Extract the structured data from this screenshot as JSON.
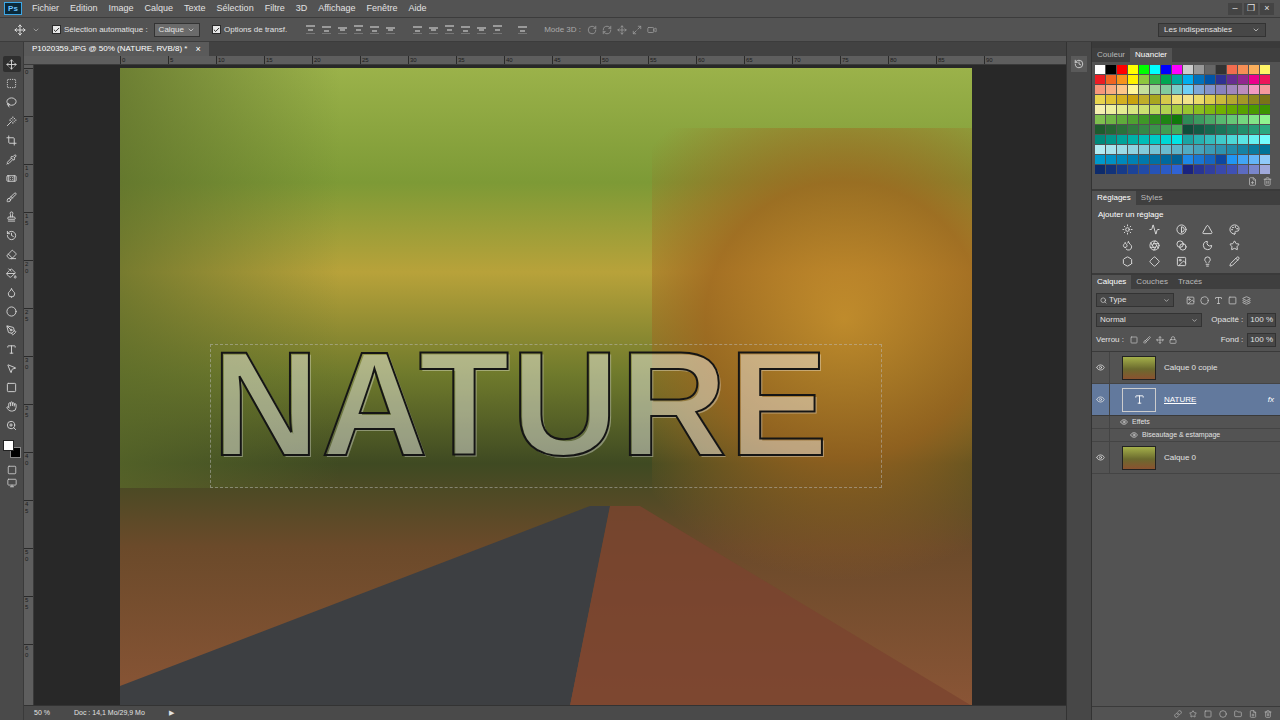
{
  "app": {
    "logo": "Ps"
  },
  "menu": [
    "Fichier",
    "Edition",
    "Image",
    "Calque",
    "Texte",
    "Sélection",
    "Filtre",
    "3D",
    "Affichage",
    "Fenêtre",
    "Aide"
  ],
  "window_controls": [
    "–",
    "❐",
    "×"
  ],
  "options_bar": {
    "auto_select": {
      "label": "Sélection automatique :",
      "checked": true
    },
    "auto_select_target": "Calque",
    "transform_controls": {
      "label": "Options de transf.",
      "checked": true
    },
    "mode_3d_label": "Mode 3D :",
    "workspace": "Les indispensables"
  },
  "document_tab": {
    "title": "P1020359.JPG @ 50% (NATURE, RVB/8) *",
    "close": "×"
  },
  "ruler_h": [
    "0",
    "5",
    "10",
    "15",
    "20",
    "25",
    "30",
    "35",
    "40",
    "45",
    "50",
    "55",
    "60",
    "65",
    "70",
    "75",
    "80",
    "85",
    "90"
  ],
  "ruler_v": [
    "0",
    "5",
    "10",
    "15",
    "20",
    "25",
    "30",
    "35",
    "40",
    "45",
    "50",
    "55",
    "60"
  ],
  "canvas": {
    "text_layer": "NATURE"
  },
  "status_bar": {
    "zoom": "50 %",
    "doc": "Doc : 14,1 Mo/29,9 Mo",
    "arrow": "▶"
  },
  "tools": [
    {
      "selected": true
    },
    {
      "selected": false
    },
    {
      "selected": false
    },
    {
      "selected": false
    },
    {
      "selected": false
    },
    {
      "selected": false
    },
    {
      "selected": false
    },
    {
      "selected": false
    },
    {
      "selected": false
    },
    {
      "selected": false
    },
    {
      "selected": false
    },
    {
      "selected": false
    },
    {
      "selected": false
    },
    {
      "selected": false
    },
    {
      "selected": false
    },
    {
      "selected": false
    },
    {
      "selected": false
    },
    {
      "selected": false
    },
    {
      "selected": false
    },
    {
      "selected": false
    }
  ],
  "colors": {
    "foreground": "#ffffff",
    "background": "#000000"
  },
  "panels": {
    "color": {
      "tabs": [
        {
          "label": "Couleur",
          "selected": false
        },
        {
          "label": "Nuancier",
          "selected": true
        }
      ],
      "swatches": [
        [
          "#ffffff",
          "#000000",
          "#ff0000",
          "#ffff00",
          "#00ff00",
          "#00ffff",
          "#0000ff",
          "#ff00ff",
          "#cccccc",
          "#999999",
          "#666666",
          "#333333",
          "#f26c4f",
          "#f68e55",
          "#fbaf5c",
          "#fff467"
        ],
        [
          "#ed1c24",
          "#f26522",
          "#f7941d",
          "#fff200",
          "#8dc73f",
          "#39b54a",
          "#00a651",
          "#00a99d",
          "#00aeef",
          "#0072bc",
          "#0054a6",
          "#2e3192",
          "#662d91",
          "#92278f",
          "#ec008c",
          "#ed145b"
        ],
        [
          "#f7977a",
          "#f9ad81",
          "#fdc68a",
          "#fff79a",
          "#c4df9b",
          "#a3d39c",
          "#82ca9d",
          "#7bcdc8",
          "#6ecff6",
          "#7ea7d8",
          "#8493ca",
          "#8882be",
          "#a187be",
          "#bc8dbf",
          "#f49ac2",
          "#f6989d"
        ],
        [
          "#e8d44d",
          "#e0c233",
          "#d4b021",
          "#c9a30f",
          "#bfae2a",
          "#a8a620",
          "#d6c94a",
          "#efe07a",
          "#f2e38b",
          "#eadb6a",
          "#dccc4c",
          "#c8b93a",
          "#b5a82f",
          "#a39827",
          "#8f861f",
          "#7a7318"
        ],
        [
          "#f5f0b0",
          "#eef0a0",
          "#e4ec90",
          "#d8e680",
          "#cce070",
          "#bfd960",
          "#b2d250",
          "#a5cb40",
          "#98c430",
          "#8bbd20",
          "#7eb610",
          "#71af00",
          "#64a800",
          "#57a100",
          "#4a9a00",
          "#3d9300"
        ],
        [
          "#7fbf4f",
          "#6fb545",
          "#5fab3b",
          "#4fa131",
          "#3f9727",
          "#2f8d1d",
          "#1f8313",
          "#0f7909",
          "#2e8b57",
          "#3c9a5f",
          "#4aa967",
          "#58b86f",
          "#66c777",
          "#74d67f",
          "#82e587",
          "#90f48f"
        ],
        [
          "#1e5b2e",
          "#246634",
          "#2a713a",
          "#307c40",
          "#368746",
          "#3c924c",
          "#429d52",
          "#48a858",
          "#0f4d3a",
          "#135a44",
          "#17674e",
          "#1b7458",
          "#1f8162",
          "#238e6c",
          "#279b76",
          "#2ba880"
        ],
        [
          "#00897b",
          "#00968a",
          "#00a399",
          "#00b0a8",
          "#00bdb7",
          "#00cac6",
          "#00d7d5",
          "#00e4e4",
          "#1aa3a3",
          "#26b0b0",
          "#33bdbd",
          "#40caca",
          "#4dd7d7",
          "#5ae4e4",
          "#66f0f0",
          "#73fdfd"
        ],
        [
          "#b2ebf2",
          "#a6e3ec",
          "#9adbe6",
          "#8ed3e0",
          "#82cbda",
          "#76c3d4",
          "#6abbce",
          "#5eb3c8",
          "#52abc2",
          "#46a3bc",
          "#3a9bb6",
          "#2e93b0",
          "#228baa",
          "#1683a4",
          "#0a7b9e",
          "#007398"
        ],
        [
          "#0099cc",
          "#0091c4",
          "#0089bc",
          "#0081b4",
          "#0079ac",
          "#0071a4",
          "#00699c",
          "#006194",
          "#1e88e5",
          "#1976d2",
          "#1565c0",
          "#0d47a1",
          "#2196f3",
          "#42a5f5",
          "#64b5f6",
          "#90caf9"
        ],
        [
          "#0d2b6b",
          "#12337a",
          "#173b89",
          "#1c4398",
          "#214ba7",
          "#2653b6",
          "#2b5bc5",
          "#3063d4",
          "#1a237e",
          "#283593",
          "#303f9f",
          "#3949ab",
          "#3f51b5",
          "#5c6bc0",
          "#7986cb",
          "#9fa8da"
        ]
      ]
    },
    "adjustments": {
      "tabs": [
        {
          "label": "Réglages",
          "selected": true
        },
        {
          "label": "Styles",
          "selected": false
        }
      ],
      "heading": "Ajouter un réglage"
    },
    "layers": {
      "tabs": [
        {
          "label": "Calques",
          "selected": true
        },
        {
          "label": "Couches",
          "selected": false
        },
        {
          "label": "Tracés",
          "selected": false
        }
      ],
      "filter": "Type",
      "blend_mode": "Normal",
      "opacity_label": "Opacité :",
      "opacity": "100 %",
      "lock_label": "Verrou :",
      "fill_label": "Fond :",
      "fill": "100 %",
      "items": [
        {
          "name": "Calque 0 copie",
          "kind": "pixel",
          "visible": true,
          "selected": false,
          "fx": ""
        },
        {
          "name": "NATURE",
          "kind": "text",
          "visible": true,
          "selected": true,
          "fx": "fx"
        },
        {
          "name": "Effets",
          "kind": "effects",
          "visible": true,
          "selected": false,
          "fx": ""
        },
        {
          "name": "Biseautage & estampage",
          "kind": "effect",
          "visible": true,
          "selected": false,
          "fx": ""
        },
        {
          "name": "Calque 0",
          "kind": "pixel",
          "visible": true,
          "selected": false,
          "fx": ""
        }
      ]
    }
  }
}
